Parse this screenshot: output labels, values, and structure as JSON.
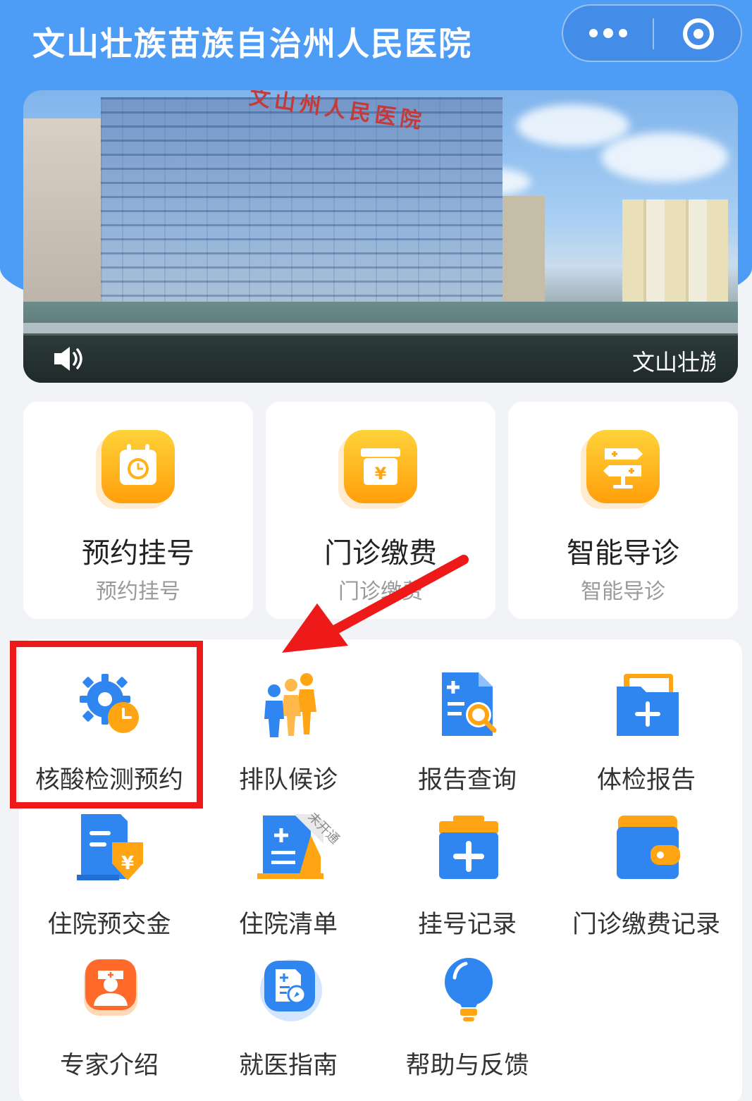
{
  "header": {
    "title": "文山壮族苗族自治州人民医院",
    "more_icon": "more-dots-icon",
    "close_icon": "target-close-icon"
  },
  "banner": {
    "building_sign": "文山州人民医院",
    "marquee_text": "文山壮族",
    "speaker_icon": "speaker-icon"
  },
  "cards": [
    {
      "title": "预约挂号",
      "subtitle": "预约挂号",
      "icon": "calendar-clock-icon"
    },
    {
      "title": "门诊缴费",
      "subtitle": "门诊缴费",
      "icon": "payment-box-icon"
    },
    {
      "title": "智能导诊",
      "subtitle": "智能导诊",
      "icon": "signpost-icon"
    }
  ],
  "grid": [
    {
      "label": "核酸检测预约",
      "icon": "gear-clock-icon"
    },
    {
      "label": "排队候诊",
      "icon": "queue-people-icon"
    },
    {
      "label": "报告查询",
      "icon": "report-search-icon"
    },
    {
      "label": "体检报告",
      "icon": "folder-plus-icon"
    },
    {
      "label": "住院预交金",
      "icon": "deposit-doc-icon"
    },
    {
      "label": "住院清单",
      "icon": "hospital-list-icon",
      "badge": "未开通"
    },
    {
      "label": "挂号记录",
      "icon": "register-record-icon"
    },
    {
      "label": "门诊缴费记录",
      "icon": "wallet-icon"
    },
    {
      "label": "专家介绍",
      "icon": "doctor-icon"
    },
    {
      "label": "就医指南",
      "icon": "guide-compass-icon"
    },
    {
      "label": "帮助与反馈",
      "icon": "lightbulb-icon"
    }
  ],
  "colors": {
    "primary": "#4d9cf5",
    "orange": "#ff9f0a",
    "annotation_red": "#ee1a1a"
  }
}
